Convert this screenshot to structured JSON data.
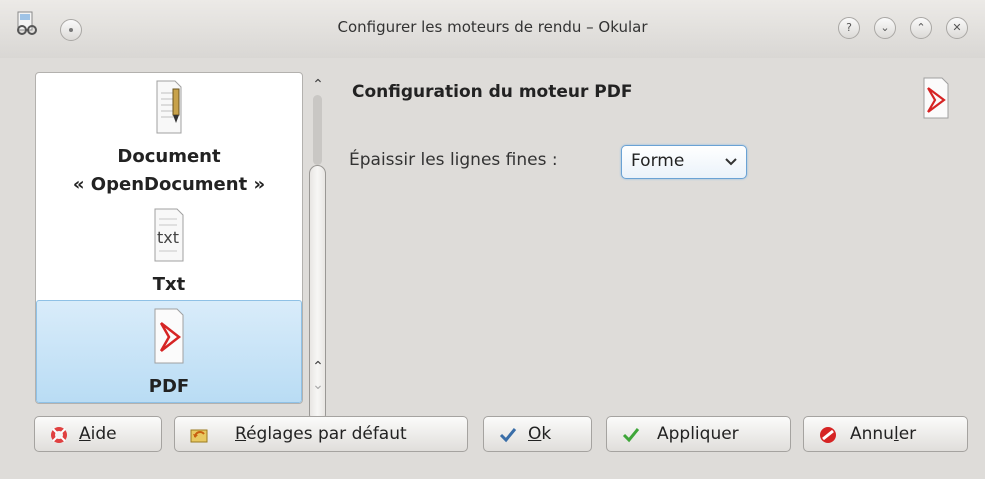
{
  "window": {
    "title": "Configurer les moteurs de rendu – Okular"
  },
  "titlebar_buttons": {
    "help": "?",
    "minimize": "⌄",
    "maximize": "⌃",
    "close": "✕"
  },
  "sidebar": {
    "items": [
      {
        "label_line1": "Document",
        "label_line2": "« OpenDocument »",
        "icon": "opendocument-icon"
      },
      {
        "label": "Txt",
        "icon": "txt-icon"
      },
      {
        "label": "PDF",
        "icon": "pdf-icon",
        "selected": true
      }
    ],
    "scroll_up": "⌃",
    "scroll_up2": "⌃",
    "scroll_down": "⌄"
  },
  "panel": {
    "title": "Configuration du moteur PDF",
    "thin_lines_label": "Épaissir les lignes fines :",
    "thin_lines_value": "Forme"
  },
  "buttons": {
    "help": {
      "pre": "",
      "ul": "A",
      "post": "ide"
    },
    "defaults": {
      "pre": "",
      "ul": "R",
      "post": "églages par défaut"
    },
    "ok": {
      "pre": "",
      "ul": "O",
      "post": "k"
    },
    "apply": {
      "pre": "Appliquer",
      "ul": "",
      "post": ""
    },
    "cancel": {
      "pre": "Annu",
      "ul": "l",
      "post": "er"
    }
  },
  "colors": {
    "accent": "#6aa2d4",
    "selection": "#c6e3f7",
    "pdf_red": "#d62424",
    "ok_blue": "#3a6ea8",
    "apply_green": "#3fa63a"
  }
}
